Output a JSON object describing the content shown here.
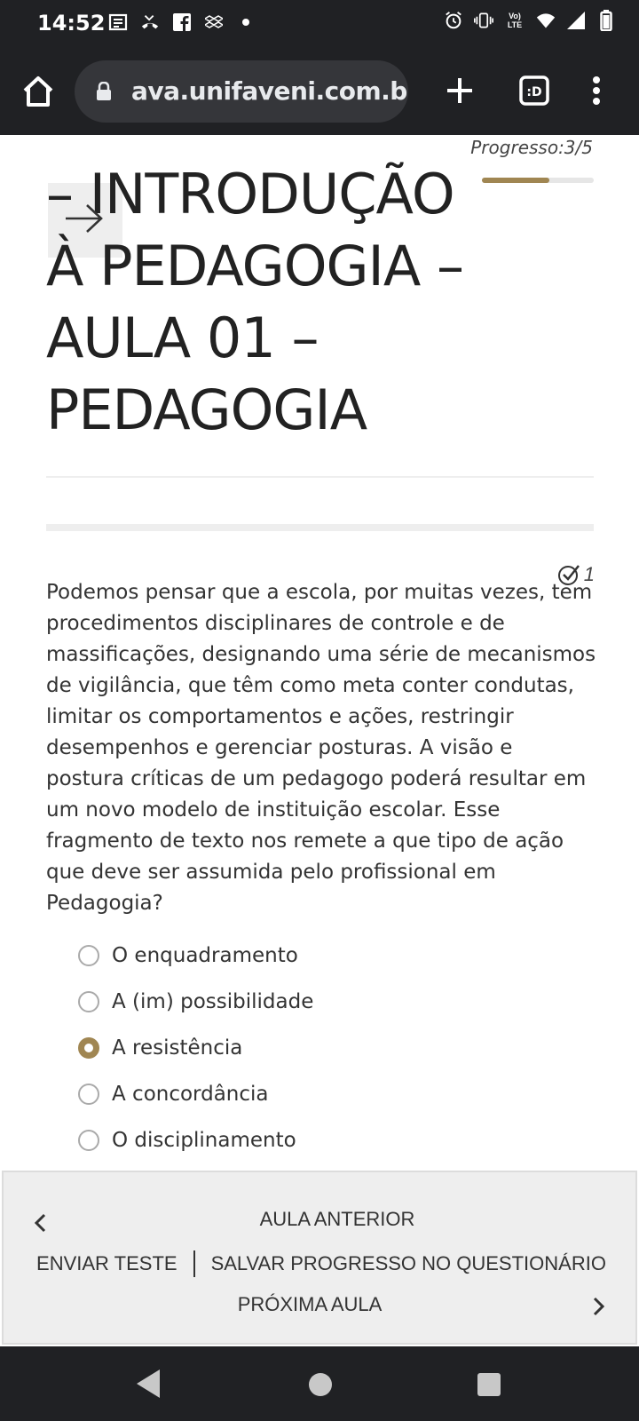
{
  "status_bar": {
    "time": "14:52",
    "left_icons": [
      "news-icon",
      "missed-call-icon",
      "facebook-icon",
      "dropbox-icon",
      "dot-icon"
    ],
    "right_icons": [
      "alarm-icon",
      "vibrate-icon",
      "volte-icon",
      "wifi-icon",
      "signal-icon",
      "battery-icon"
    ],
    "volte_text": "Vo)\nLTE"
  },
  "browser": {
    "url": "ava.unifaveni.com.br/c"
  },
  "progress": {
    "label": "Progresso:3/5",
    "fraction": 0.6,
    "color": "#a08652"
  },
  "lesson": {
    "title": "– INTRODUÇÃO À PEDAGOGIA – AULA 01 – PEDAGOGIA"
  },
  "question": {
    "points": "1",
    "text": "Podemos pensar que a escola, por muitas vezes, tem procedimentos disciplinares de controle e de massificações, designando uma série de mecanismos de vigilância, que têm como meta conter condutas, limitar os comportamentos e ações, restringir desempenhos e gerenciar posturas. A visão e postura críticas de um pedagogo poderá resultar em um novo modelo de instituição escolar. Esse fragmento de texto nos remete a que tipo de ação que deve ser assumida pelo profissional em Pedagogia?",
    "options": [
      {
        "label": "O enquadramento",
        "selected": false
      },
      {
        "label": "A (im) possibilidade",
        "selected": false
      },
      {
        "label": "A resistência",
        "selected": true
      },
      {
        "label": "A concordância",
        "selected": false
      },
      {
        "label": "O disciplinamento",
        "selected": false
      }
    ]
  },
  "nav": {
    "prev_label": "AULA ANTERIOR",
    "send_test_label": "ENVIAR TESTE",
    "save_progress_label": "SALVAR PROGRESSO NO QUESTIONÁRIO",
    "next_label": "PRÓXIMA AULA"
  }
}
